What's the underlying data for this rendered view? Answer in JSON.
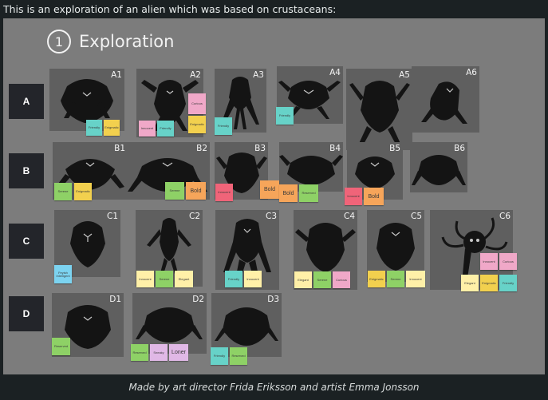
{
  "intro": "This is an exploration of an alien which was based on crustaceans:",
  "caption": "Made by art director Frida Eriksson and artist Emma Jonsson",
  "section": {
    "number": "1",
    "title": "Exploration"
  },
  "rows": [
    "A",
    "B",
    "C",
    "D"
  ],
  "cards": [
    {
      "label": "A1"
    },
    {
      "label": "A2"
    },
    {
      "label": "A3"
    },
    {
      "label": "A4"
    },
    {
      "label": "A5"
    },
    {
      "label": "A6"
    },
    {
      "label": "B1"
    },
    {
      "label": "B2"
    },
    {
      "label": "B3"
    },
    {
      "label": "B4"
    },
    {
      "label": "B5"
    },
    {
      "label": "B6"
    },
    {
      "label": "C1"
    },
    {
      "label": "C2"
    },
    {
      "label": "C3"
    },
    {
      "label": "C4"
    },
    {
      "label": "C5"
    },
    {
      "label": "C6"
    },
    {
      "label": "D1"
    },
    {
      "label": "D2"
    },
    {
      "label": "D3"
    }
  ],
  "tags": [
    "Friendly",
    "Enigmatic",
    "Innocent",
    "Friendly",
    "Curious",
    "Enigmatic",
    "Friendly",
    "Friendly",
    "Serene",
    "Enigmatic",
    "Serene",
    "Bold",
    "Innocent",
    "Bold",
    "Bold",
    "Reserved",
    "Innocent",
    "Bold",
    "Feyish Intelligent",
    "Innocent",
    "Serene",
    "Elegant",
    "Friendly",
    "Innocent",
    "Elegant",
    "Serene",
    "Curious",
    "Enigmatic",
    "Serene",
    "Innocent",
    "Innocent",
    "Curious",
    "Elegant",
    "Enigmatic",
    "Friendly",
    "Reserved",
    "Reserved",
    "Sneaky",
    "Loner",
    "Friendly",
    "Reserved"
  ]
}
